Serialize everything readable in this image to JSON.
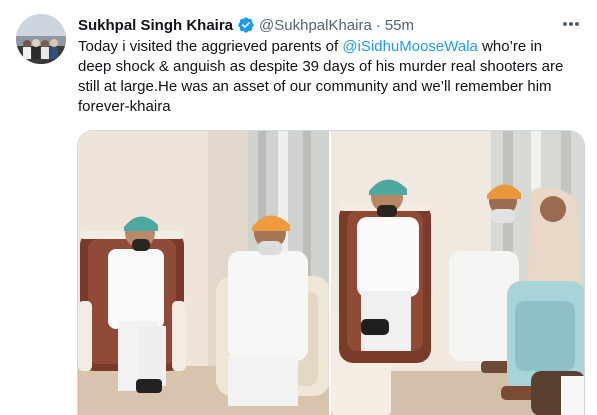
{
  "tweet": {
    "author_name": "Sukhpal Singh Khaira",
    "handle": "@SukhpalKhaira",
    "separator": "·",
    "time": "55m",
    "text_before": "Today i visited the aggrieved parents of ",
    "mention": "@iSidhuMooseWala",
    "text_after": " who’re in deep shock & anguish as despite 39 days of his murder real shooters are still at large.He was an asset of our community and we’ll remember him forever-khaira"
  },
  "icons": {
    "avatar": "avatar-photo",
    "verified": "verified-badge-icon",
    "more": "more-options-icon"
  },
  "colors": {
    "accent": "#1d9bf0",
    "text": "#0f1419",
    "secondary": "#536471"
  }
}
